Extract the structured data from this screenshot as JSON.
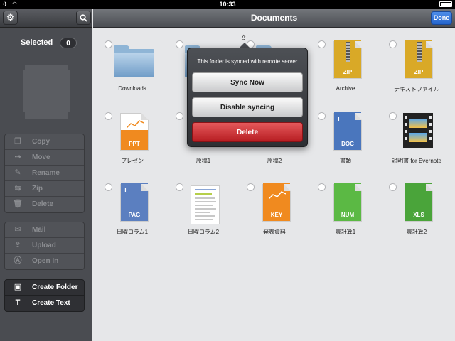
{
  "status_bar": {
    "time": "10:33",
    "airplane_icon": "airplane-icon",
    "wifi_icon": "wifi-icon",
    "battery_icon": "battery-icon"
  },
  "nav": {
    "title": "Documents",
    "done_label": "Done"
  },
  "sidebar": {
    "selected_label": "Selected",
    "selected_count": "0",
    "action_group_1": [
      {
        "label": "Copy",
        "icon": "copy-icon"
      },
      {
        "label": "Move",
        "icon": "move-icon"
      },
      {
        "label": "Rename",
        "icon": "rename-icon"
      },
      {
        "label": "Zip",
        "icon": "zip-icon"
      },
      {
        "label": "Delete",
        "icon": "trash-icon"
      }
    ],
    "action_group_2": [
      {
        "label": "Mail",
        "icon": "mail-icon"
      },
      {
        "label": "Upload",
        "icon": "upload-icon"
      },
      {
        "label": "Open In",
        "icon": "open-in-icon"
      }
    ],
    "action_group_3": [
      {
        "label": "Create Folder",
        "icon": "create-folder-icon"
      },
      {
        "label": "Create Text",
        "icon": "create-text-icon"
      }
    ]
  },
  "files": [
    {
      "name": "Downloads",
      "kind": "folder"
    },
    {
      "name": "",
      "kind": "folder"
    },
    {
      "name": "",
      "kind": "folder"
    },
    {
      "name": "Archive",
      "kind": "zip",
      "ext": "ZIP"
    },
    {
      "name": "テキストファイル",
      "kind": "zip",
      "ext": "ZIP"
    },
    {
      "name": "プレゼン",
      "kind": "ppt",
      "ext": "PPT"
    },
    {
      "name": "原稿1",
      "kind": "doc"
    },
    {
      "name": "原稿2",
      "kind": "doc"
    },
    {
      "name": "書類",
      "kind": "doc",
      "ext": "DOC"
    },
    {
      "name": "説明書 for Evernote",
      "kind": "video"
    },
    {
      "name": "日曜コラム1",
      "kind": "pages",
      "ext": "PAG"
    },
    {
      "name": "日曜コラム2",
      "kind": "thumb"
    },
    {
      "name": "発表資料",
      "kind": "key",
      "ext": "KEY"
    },
    {
      "name": "表計算1",
      "kind": "numbers",
      "ext": "NUM"
    },
    {
      "name": "表計算2",
      "kind": "xls",
      "ext": "XLS"
    }
  ],
  "popover": {
    "message": "This folder is synced with remote server",
    "sync_now": "Sync Now",
    "disable_syncing": "Disable syncing",
    "delete": "Delete"
  },
  "colors": {
    "accent_blue": "#2565cc",
    "delete_red": "#c8282d",
    "zip_gold": "#d9a927",
    "ppt_orange": "#f08a1f",
    "doc_blue": "#4a76bd",
    "num_green": "#5bb944",
    "xls_green": "#4aa43a"
  }
}
